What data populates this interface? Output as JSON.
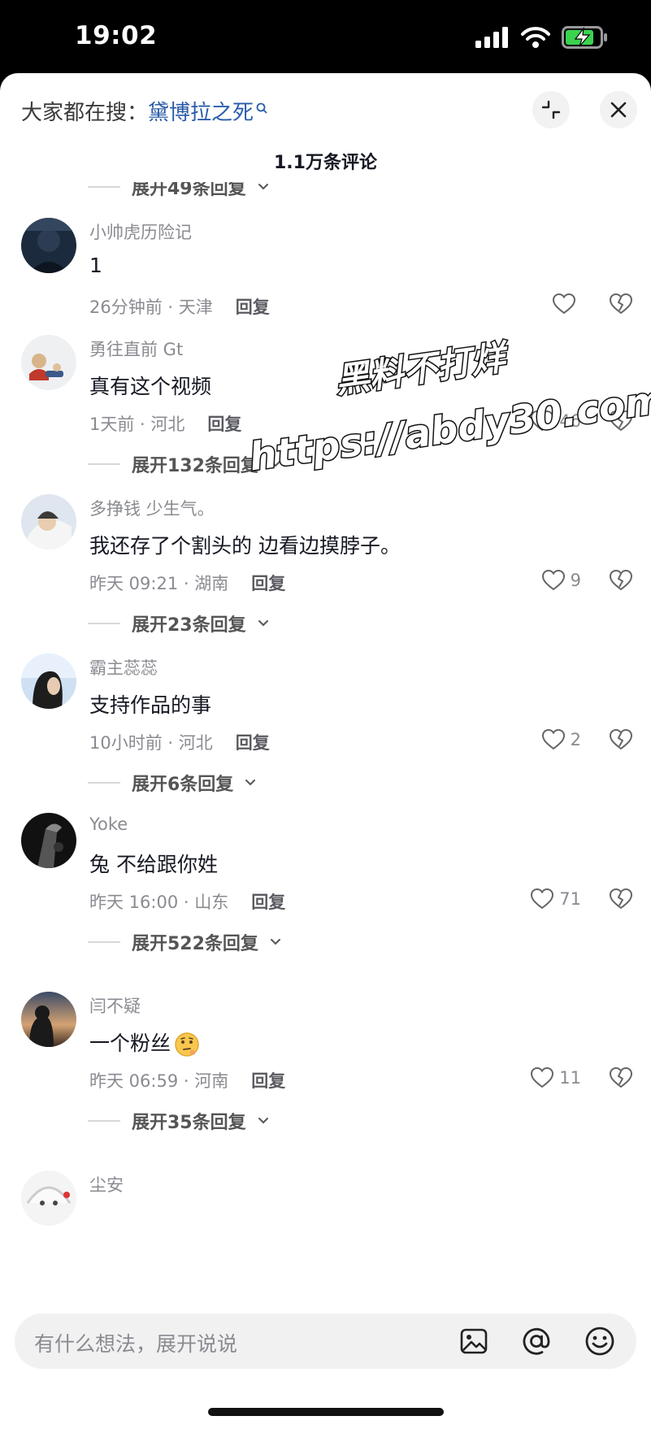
{
  "status_bar": {
    "time": "19:02"
  },
  "header": {
    "search_prefix": "大家都在搜：",
    "search_term": "黛博拉之死",
    "comment_count": "1.1万条评论"
  },
  "partial_expand": "展开49条回复",
  "comments": [
    {
      "user": "小帅虎历险记",
      "text": "1",
      "time": "26分钟前 · 天津",
      "reply": "回复",
      "likes": "",
      "expand": ""
    },
    {
      "user": "勇往直前 Gt",
      "text": "真有这个视频",
      "time": "1天前 · 河北",
      "reply": "回复",
      "likes": "46",
      "expand": "展开132条回复"
    },
    {
      "user": "多挣钱 少生气。",
      "text": "我还存了个割头的 边看边摸脖子。",
      "time": "昨天 09:21 · 湖南",
      "reply": "回复",
      "likes": "9",
      "expand": "展开23条回复"
    },
    {
      "user": "霸主蕊蕊",
      "text": "支持作品的事",
      "time": "10小时前 · 河北",
      "reply": "回复",
      "likes": "2",
      "expand": "展开6条回复"
    },
    {
      "user": "Yoke",
      "text": "兔 不给跟你姓",
      "time": "昨天 16:00 · 山东",
      "reply": "回复",
      "likes": "71",
      "expand": "展开522条回复"
    },
    {
      "user": "闫不疑",
      "text": "一个粉丝",
      "time": "昨天 06:59 · 河南",
      "reply": "回复",
      "likes": "11",
      "expand": "展开35条回复"
    },
    {
      "user": "尘安"
    }
  ],
  "watermark": {
    "line1": "黑料不打烊",
    "line2": "https://abdy30.com"
  },
  "input": {
    "placeholder": "有什么想法，展开说说"
  },
  "icons": {
    "search": "search-icon",
    "collapse": "collapse-icon",
    "close": "close-icon",
    "heart": "heart-icon",
    "dislike": "broken-heart-icon",
    "chevron": "chevron-down-icon",
    "image": "image-icon",
    "mention": "at-icon",
    "emoji": "emoji-icon"
  },
  "colors": {
    "link": "#2a5caa",
    "muted": "#8a8b91",
    "text": "#161823"
  }
}
